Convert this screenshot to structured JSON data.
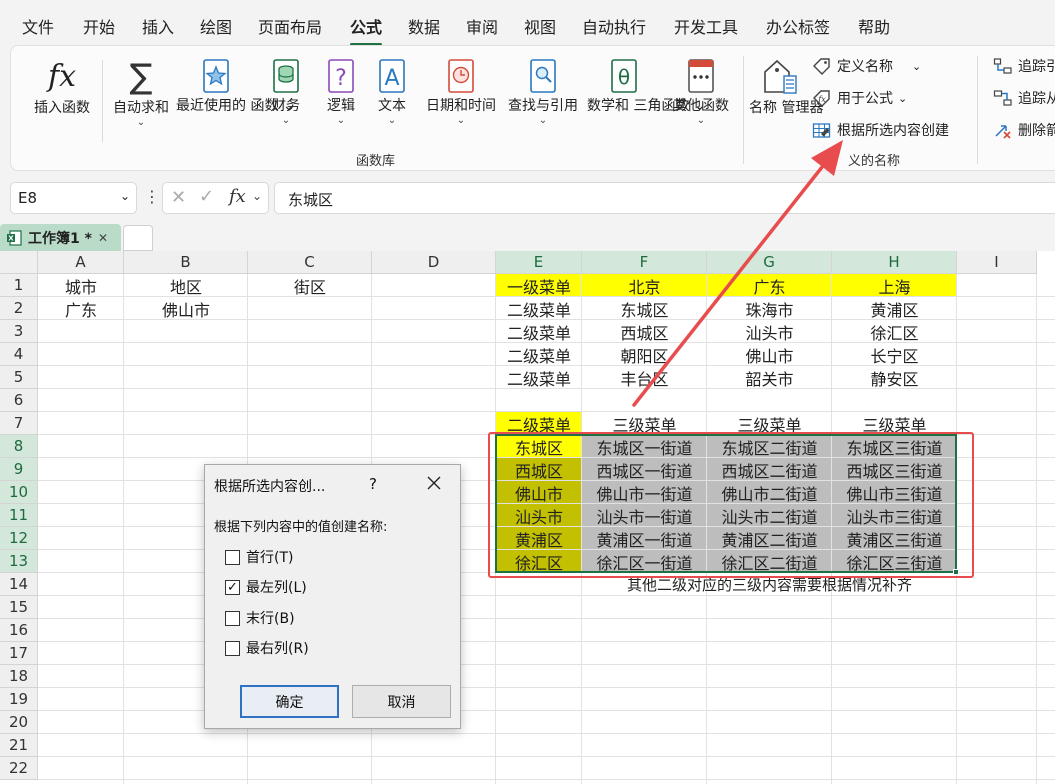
{
  "menu": {
    "tabs": [
      "文件",
      "开始",
      "插入",
      "绘图",
      "页面布局",
      "公式",
      "数据",
      "审阅",
      "视图",
      "自动执行",
      "开发工具",
      "办公标签",
      "帮助"
    ],
    "active": "公式"
  },
  "ribbon": {
    "insert_function": "插入函数",
    "autosum": "自动求和",
    "recent_line1": "最近使用的",
    "recent_line2": "函数",
    "financial": "财务",
    "logical": "逻辑",
    "text": "文本",
    "datetime": "日期和时间",
    "lookup": "查找与引用",
    "math_line1": "数学和",
    "math_line2": "三角函数",
    "more": "其他函数",
    "function_library_label": "函数库",
    "name_manager_line1": "名称",
    "name_manager_line2": "管理器",
    "define_name": "定义名称",
    "use_in_formula": "用于公式",
    "create_from_selection": "根据所选内容创建",
    "defined_names_label": "义的名称",
    "trace_precedents": "追踪引",
    "trace_dependents": "追踪从",
    "remove_arrows": "删除箭"
  },
  "formula_bar": {
    "name_box": "E8",
    "content": "东城区"
  },
  "workbook": {
    "tab_label": "工作簿1 *"
  },
  "sheet": {
    "columns": [
      "A",
      "B",
      "C",
      "D",
      "E",
      "F",
      "G",
      "H",
      "I"
    ],
    "rows": [
      "1",
      "2",
      "3",
      "4",
      "5",
      "6",
      "7",
      "8",
      "9",
      "10",
      "11",
      "12",
      "13",
      "14",
      "15",
      "16",
      "17",
      "18",
      "19",
      "20",
      "21",
      "22"
    ],
    "cells": {
      "A1": "城市",
      "B1": "地区",
      "C1": "街区",
      "A2": "广东",
      "B2": "佛山市",
      "E1": "一级菜单",
      "F1": "北京",
      "G1": "广东",
      "H1": "上海",
      "E2": "二级菜单",
      "F2": "东城区",
      "G2": "珠海市",
      "H2": "黄浦区",
      "E3": "二级菜单",
      "F3": "西城区",
      "G3": "汕头市",
      "H3": "徐汇区",
      "E4": "二级菜单",
      "F4": "朝阳区",
      "G4": "佛山市",
      "H4": "长宁区",
      "E5": "二级菜单",
      "F5": "丰台区",
      "G5": "韶关市",
      "H5": "静安区",
      "E7": "二级菜单",
      "F7": "三级菜单",
      "G7": "三级菜单",
      "H7": "三级菜单",
      "E8": "东城区",
      "F8": "东城区一街道",
      "G8": "东城区二街道",
      "H8": "东城区三街道",
      "E9": "西城区",
      "F9": "西城区一街道",
      "G9": "西城区二街道",
      "H9": "西城区三街道",
      "E10": "佛山市",
      "F10": "佛山市一街道",
      "G10": "佛山市二街道",
      "H10": "佛山市三街道",
      "E11": "汕头市",
      "F11": "汕头市一街道",
      "G11": "汕头市二街道",
      "H11": "汕头市三街道",
      "E12": "黄浦区",
      "F12": "黄浦区一街道",
      "G12": "黄浦区二街道",
      "H12": "黄浦区三街道",
      "E13": "徐汇区",
      "F13": "徐汇区一街道",
      "G13": "徐汇区二街道",
      "H13": "徐汇区三街道"
    },
    "note_row14": "其他二级对应的三级内容需要根据情况补齐"
  },
  "dialog": {
    "title": "根据所选内容创...",
    "help": "?",
    "prompt": "根据下列内容中的值创建名称:",
    "options": [
      {
        "label": "首行(T)",
        "checked": false
      },
      {
        "label": "最左列(L)",
        "checked": true
      },
      {
        "label": "末行(B)",
        "checked": false
      },
      {
        "label": "最右列(R)",
        "checked": false
      }
    ],
    "ok": "确定",
    "cancel": "取消"
  },
  "colors": {
    "accent_green": "#1e7145",
    "yellow_fill": "#ffff00",
    "olive_fill": "#c2c000",
    "gray_fill": "#bdbdbd",
    "annotation_red": "#e84c4c"
  }
}
